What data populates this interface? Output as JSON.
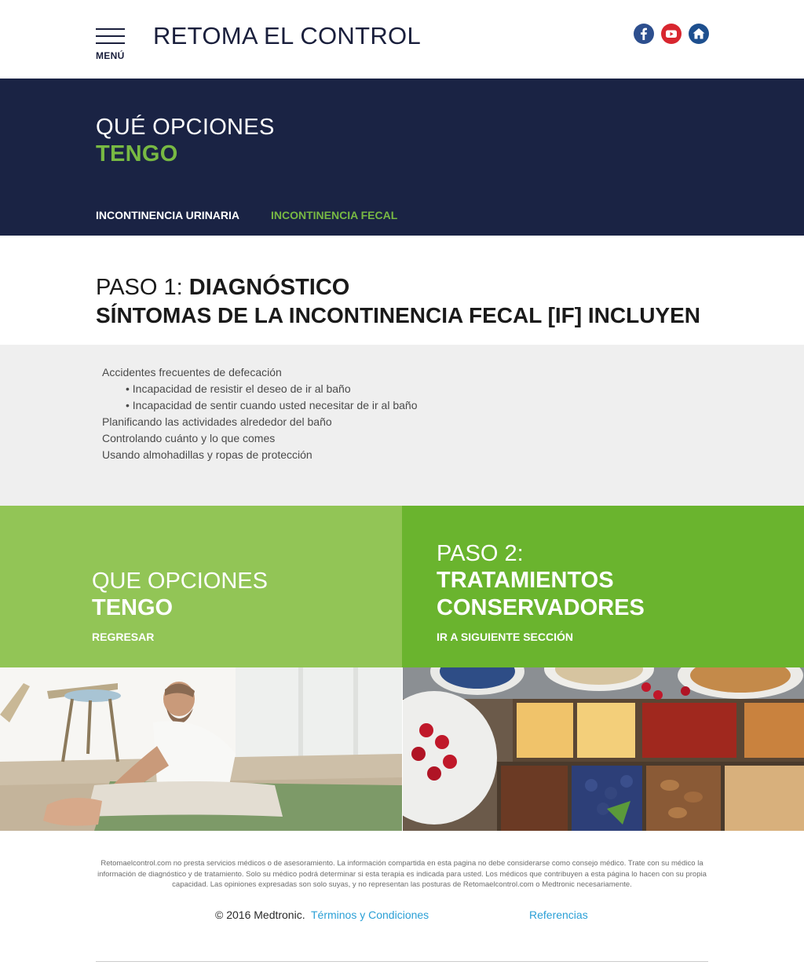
{
  "header": {
    "menu_label": "MENÚ",
    "site_title": "RETOMA EL CONTROL",
    "social": [
      {
        "icon": "facebook-icon",
        "color": "#2d4f8e"
      },
      {
        "icon": "youtube-icon",
        "color": "#d8262f"
      },
      {
        "icon": "home-icon",
        "color": "#1d4f8e"
      }
    ]
  },
  "hero": {
    "title_line1": "QUÉ OPCIONES",
    "title_line2": "TENGO",
    "tabs": [
      {
        "label": "INCONTINENCIA URINARIA",
        "active": false
      },
      {
        "label": "INCONTINENCIA FECAL",
        "active": true
      }
    ]
  },
  "step1": {
    "prefix": "PASO 1:",
    "title": "DIAGNÓSTICO",
    "subtitle": "SÍNTOMAS DE LA INCONTINENCIA FECAL [IF] INCLUYEN"
  },
  "symptoms": {
    "items": [
      {
        "text": "Accidentes frecuentes de defecación",
        "sub": false
      },
      {
        "text": "• Incapacidad de resistir el deseo de ir al baño",
        "sub": true
      },
      {
        "text": "• Incapacidad de sentir cuando usted necesitar de ir al baño",
        "sub": true
      },
      {
        "text": "Planificando las actividades alrededor del baño",
        "sub": false
      },
      {
        "text": "Controlando cuánto y lo que comes",
        "sub": false
      },
      {
        "text": "Usando almohadillas y ropas de protección",
        "sub": false
      }
    ]
  },
  "nav_blocks": {
    "left": {
      "line1": "QUE OPCIONES",
      "line2": "TENGO",
      "link": "REGRESAR"
    },
    "right": {
      "line1": "PASO 2:",
      "line2": "TRATAMIENTOS",
      "line3": "CONSERVADORES",
      "link": "IR A SIGUIENTE SECCIÓN"
    }
  },
  "colors": {
    "navy": "#1a2344",
    "accent_green": "#78b943",
    "light_green": "#92c556",
    "dark_green": "#6ab42e",
    "link_blue": "#2a9fd6"
  },
  "footer": {
    "disclaimer": "Retomaelcontrol.com no presta servicios médicos o de asesoramiento. La información compartida en esta pagina no debe considerarse como consejo médico. Trate con su médico la información de diagnóstico y de tratamiento. Solo su médico podrá determinar si esta terapia es indicada para usted. Los médicos que contribuyen a esta página lo hacen con su propia capacidad. Las opiniones expresadas son solo suyas, y no representan las posturas de Retomaelcontrol.com o Medtronic necesariamente.",
    "copyright": "© 2016 Medtronic.",
    "terms": "Términos y Condiciones",
    "references": "Referencias"
  }
}
